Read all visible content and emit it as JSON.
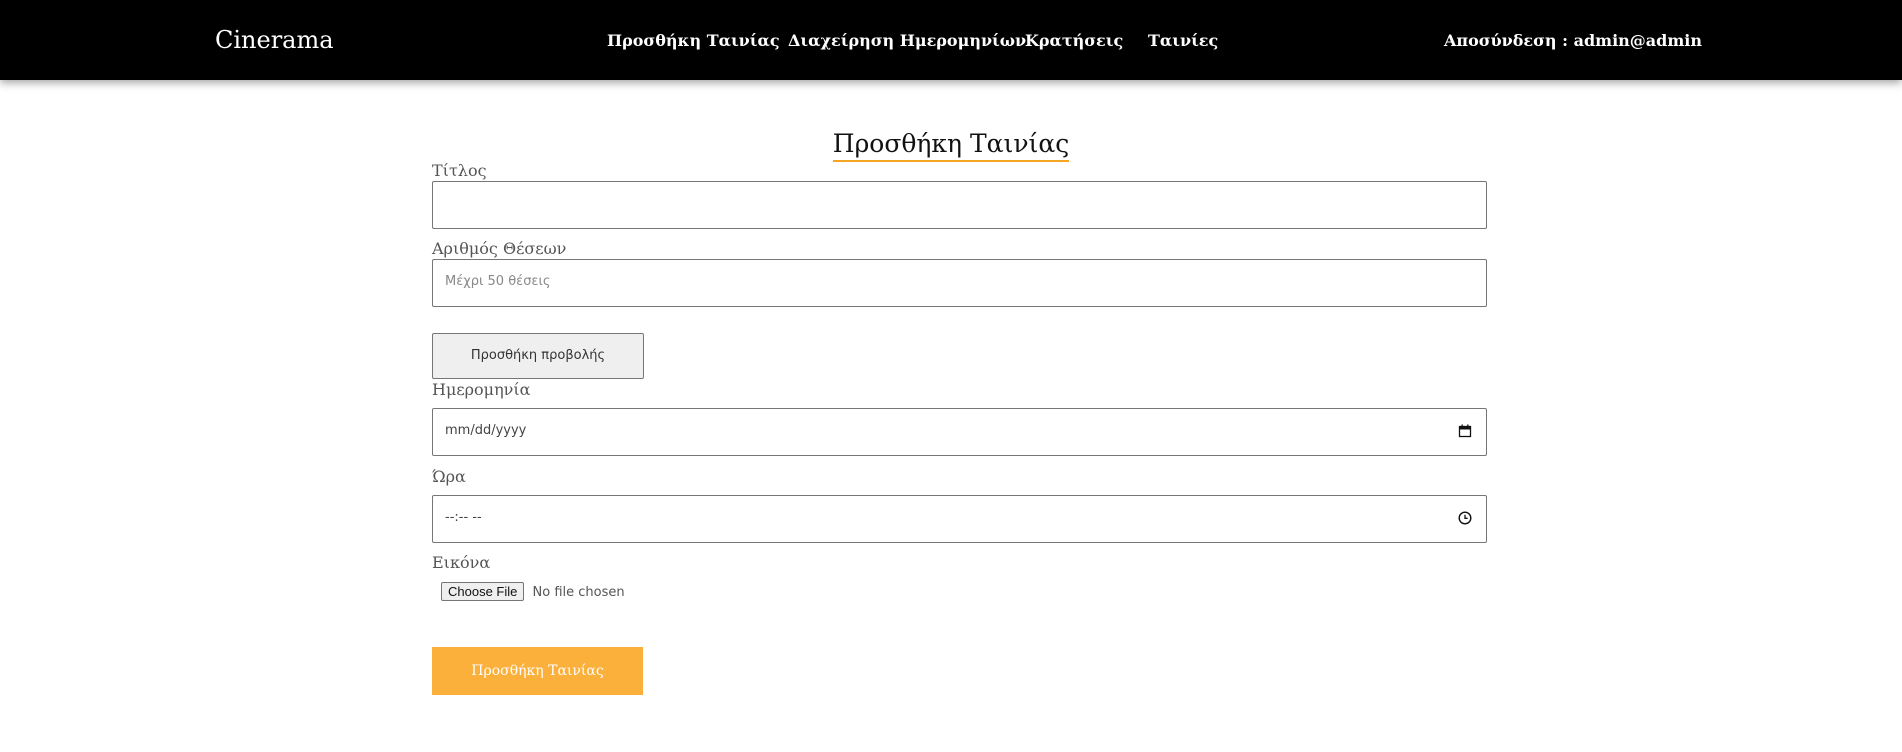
{
  "nav": {
    "brand": "Cinerama",
    "links": [
      "Προσθήκη Ταινίας",
      "Διαχείρηση Ημερομηνίων",
      "Κρατήσεις",
      "Ταινίες"
    ],
    "logout": "Αποσύνδεση : admin@admin"
  },
  "page": {
    "title": "Προσθήκη Ταινίας"
  },
  "form": {
    "title_label": "Τίτλος",
    "title_value": "",
    "seats_label": "Αριθμός Θέσεων",
    "seats_placeholder": "Μέχρι 50 θέσεις",
    "add_screening_button": "Προσθήκη προβολής",
    "date_label": "Ημερομηνία",
    "date_value": "mm/dd/yyyy",
    "time_label": "Ώρα",
    "time_value": "--:-- --",
    "image_label": "Εικόνα",
    "choose_file_button": "Choose File",
    "file_status": "No file chosen",
    "submit_button": "Προσθήκη Ταινίας"
  },
  "colors": {
    "navbar": "#000000",
    "accent": "#fbb03b"
  }
}
